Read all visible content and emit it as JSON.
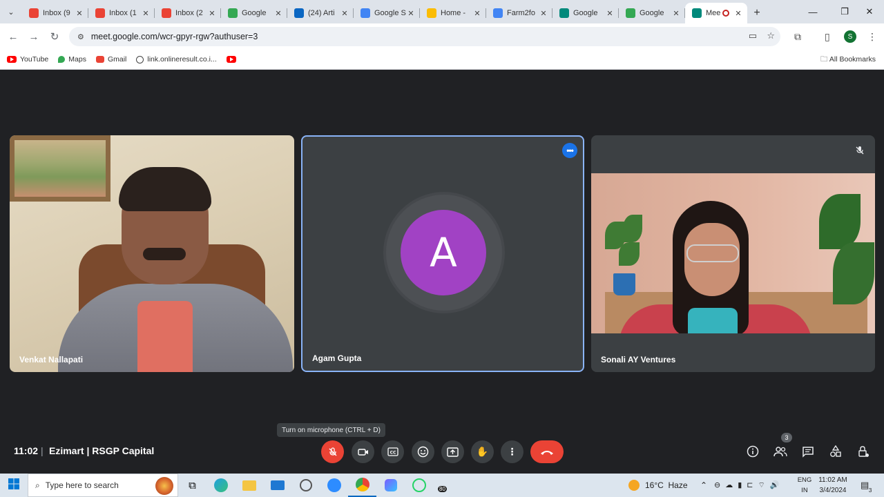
{
  "browser": {
    "tabs": [
      {
        "label": "Inbox (9",
        "icon": "gmail-icon",
        "color": "#ea4335"
      },
      {
        "label": "Inbox (1",
        "icon": "gmail-icon",
        "color": "#ea4335"
      },
      {
        "label": "Inbox (2",
        "icon": "gmail-icon",
        "color": "#ea4335"
      },
      {
        "label": "Google",
        "icon": "google-sheets-icon",
        "color": "#34a853"
      },
      {
        "label": "(24) Arti",
        "icon": "linkedin-icon",
        "color": "#0a66c2"
      },
      {
        "label": "Google S",
        "icon": "google-icon",
        "color": "#4285f4"
      },
      {
        "label": "Home -",
        "icon": "google-drive-icon",
        "color": "#fbbc04"
      },
      {
        "label": "Farm2fo",
        "icon": "google-docs-icon",
        "color": "#4285f4"
      },
      {
        "label": "Google",
        "icon": "google-meet-icon",
        "color": "#00897b"
      },
      {
        "label": "Google",
        "icon": "google-sheets-icon",
        "color": "#34a853"
      },
      {
        "label": "Mee",
        "icon": "google-meet-icon",
        "color": "#00897b",
        "active": true
      }
    ],
    "url": "meet.google.com/wcr-gpyr-rgw?authuser=3",
    "profile_initial": "S",
    "bookmarks": [
      {
        "label": "YouTube",
        "icon": "youtube-icon"
      },
      {
        "label": "Maps",
        "icon": "maps-icon"
      },
      {
        "label": "Gmail",
        "icon": "gmail-icon"
      },
      {
        "label": "link.onlineresult.co.i...",
        "icon": "globe-icon"
      },
      {
        "label": "",
        "icon": "youtube-icon"
      }
    ],
    "all_bookmarks": "All Bookmarks"
  },
  "meet": {
    "participants": [
      {
        "name": "Venkat Nallapati"
      },
      {
        "name": "Agam Gupta",
        "initial": "A",
        "avatar_color": "#a142c4"
      },
      {
        "name": "Sonali AY Ventures"
      }
    ],
    "tooltip": "Turn on microphone (CTRL + D)",
    "clock": "11:02",
    "separator": "|",
    "meeting_name": "Ezimart | RSGP Capital",
    "people_count": "3",
    "accent": "#8ab4f8",
    "end_call_color": "#ea4335"
  },
  "taskbar": {
    "search_placeholder": "Type here to search",
    "weather": "16°C  Haze",
    "lang_line1": "ENG",
    "lang_line2": "IN",
    "time": "11:02 AM",
    "date": "3/4/2024",
    "whatsapp_badge": "80",
    "notification_count": "3"
  }
}
